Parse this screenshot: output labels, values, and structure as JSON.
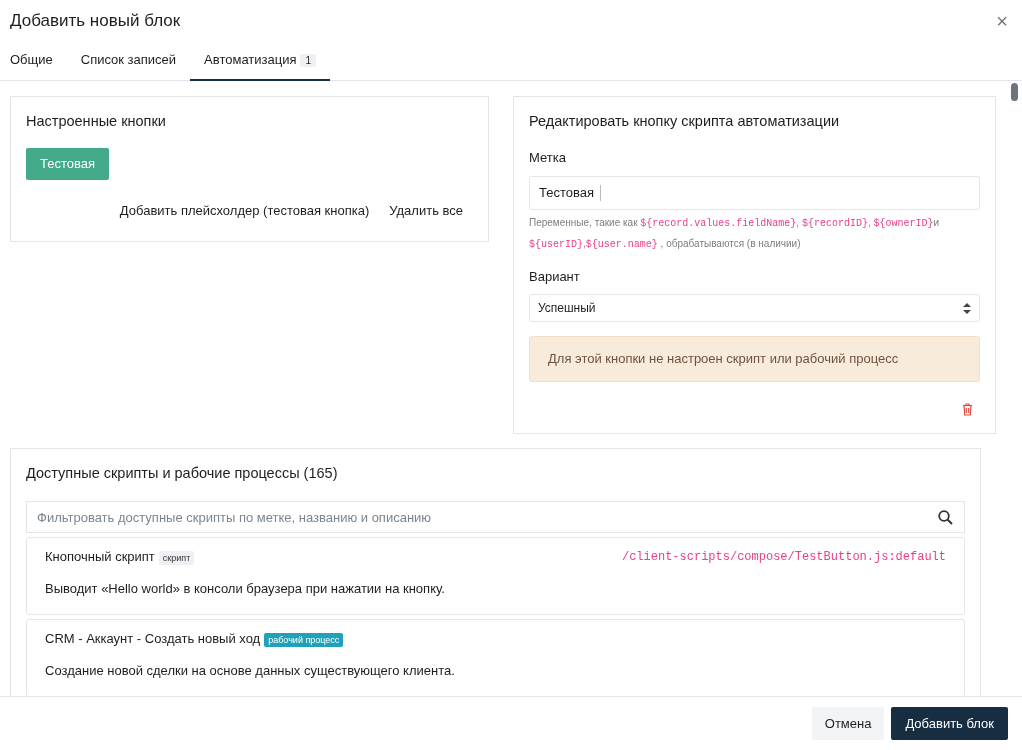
{
  "modal": {
    "title": "Добавить новый блок",
    "close": "×"
  },
  "tabs": [
    {
      "label": "Общие",
      "selected": false
    },
    {
      "label": "Список записей",
      "selected": false
    },
    {
      "label": "Автоматизация",
      "count": "1",
      "selected": true
    }
  ],
  "configured_buttons": {
    "title": "Настроенные кнопки",
    "buttons": [
      {
        "label": "Тестовая",
        "kind": "success"
      }
    ],
    "add_placeholder": "Добавить плейсхолдер (тестовая кнопка)",
    "delete_all": "Удалить все"
  },
  "edit_panel": {
    "title": "Редактировать кнопку скрипта автоматизации",
    "label_caption": "Метка",
    "label_value": "Тестовая",
    "hint": [
      {
        "kind": "text",
        "text": "Переменные, такие как "
      },
      {
        "kind": "code",
        "text": "${record.values.fieldName}"
      },
      {
        "kind": "text",
        "text": ", "
      },
      {
        "kind": "code",
        "text": "${recordID}"
      },
      {
        "kind": "text",
        "text": ", "
      },
      {
        "kind": "code",
        "text": "${ownerID}"
      },
      {
        "kind": "text",
        "text": "и "
      },
      {
        "kind": "code",
        "text": "${userID}"
      },
      {
        "kind": "text",
        "text": ","
      },
      {
        "kind": "code",
        "text": "${user.name}"
      },
      {
        "kind": "text",
        "text": " , обрабатываются (в наличии)"
      }
    ],
    "variant_caption": "Вариант",
    "variant_value": "Успешный",
    "warning": "Для этой кнопки не настроен скрипт или рабочий процесс"
  },
  "scripts": {
    "title": "Доступные скрипты и рабочие процессы (165)",
    "filter_placeholder": "Фильтровать доступные скрипты по метке, названию и описанию",
    "items": [
      {
        "name": "Кнопочный скрипт",
        "kind": "script",
        "badge": "скрипт",
        "path": "/client-scripts/compose/TestButton.js:default",
        "description": "Выводит «Hello world» в консоли браузера при нажатии на кнопку."
      },
      {
        "name": "CRM - Аккаунт - Создать новый ход",
        "kind": "workflow",
        "badge": "рабочий процесс",
        "description": "Создание новой сделки на основе данных существующего клиента."
      }
    ]
  },
  "footer": {
    "cancel": "Отмена",
    "submit": "Добавить блок"
  }
}
